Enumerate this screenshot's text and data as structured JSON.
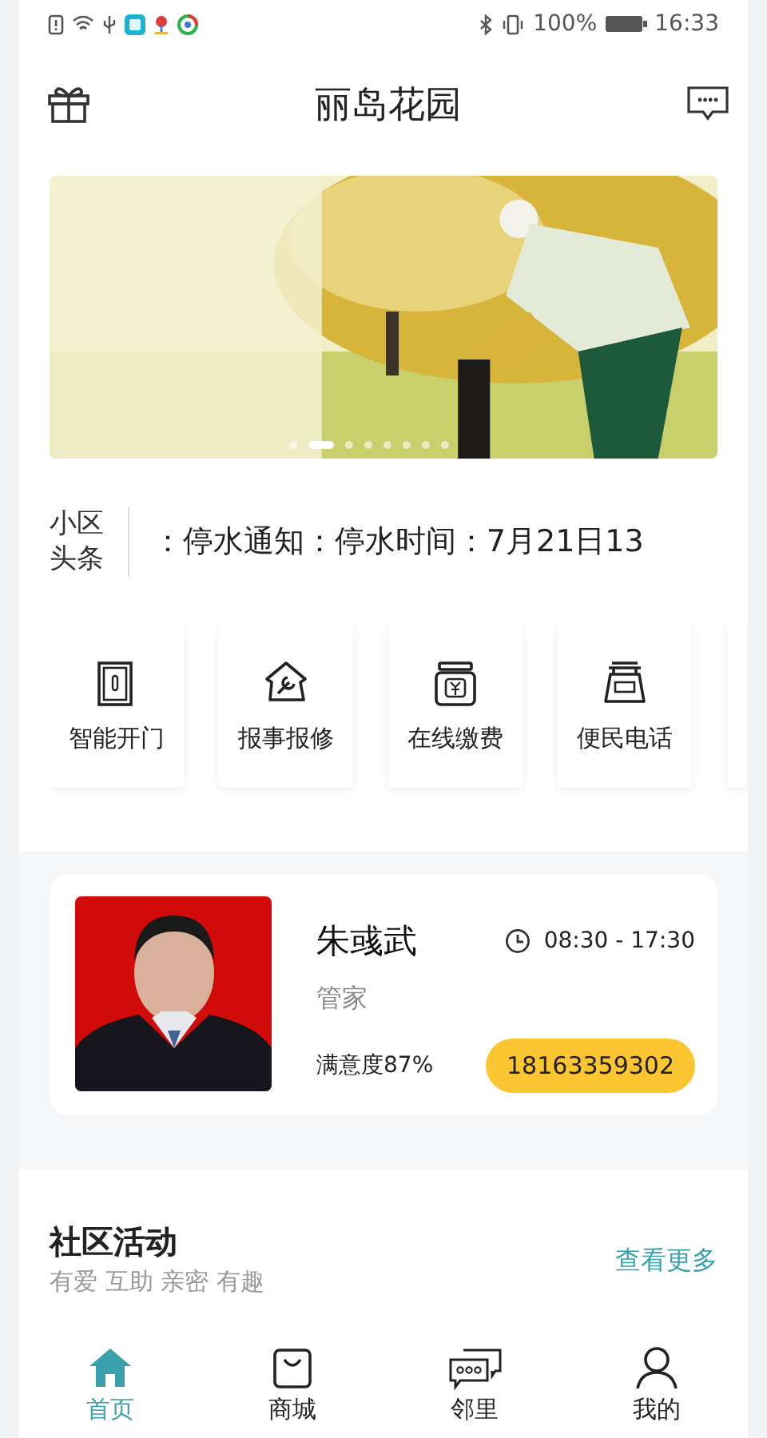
{
  "status_bar": {
    "battery": "100%",
    "time": "16:33"
  },
  "header": {
    "title": "丽岛花园"
  },
  "banner": {
    "dots": [
      {
        "selected": false
      },
      {
        "selected": true
      },
      {
        "selected": false
      },
      {
        "selected": false
      },
      {
        "selected": false
      },
      {
        "selected": false
      },
      {
        "selected": false
      },
      {
        "selected": false
      }
    ]
  },
  "headline": {
    "label": "小区头条",
    "text": "：停水通知：停水时间：7月21日13"
  },
  "services": [
    {
      "kind": "door",
      "label": "智能开门"
    },
    {
      "kind": "repair",
      "label": "报事报修"
    },
    {
      "kind": "payment",
      "label": "在线缴费"
    },
    {
      "kind": "phone",
      "label": "便民电话"
    }
  ],
  "steward": {
    "name": "朱彧武",
    "role": "管家",
    "hours": "08:30 - 17:30",
    "satisfaction": "满意度87%",
    "phone": "18163359302"
  },
  "activities": {
    "title": "社区活动",
    "subtitle": "有爱 互助 亲密 有趣",
    "more": "查看更多"
  },
  "nav": [
    {
      "kind": "home",
      "label": "首页",
      "selected": true
    },
    {
      "kind": "shop",
      "label": "商城",
      "selected": false
    },
    {
      "kind": "chat",
      "label": "邻里",
      "selected": false
    },
    {
      "kind": "user",
      "label": "我的",
      "selected": false
    }
  ]
}
